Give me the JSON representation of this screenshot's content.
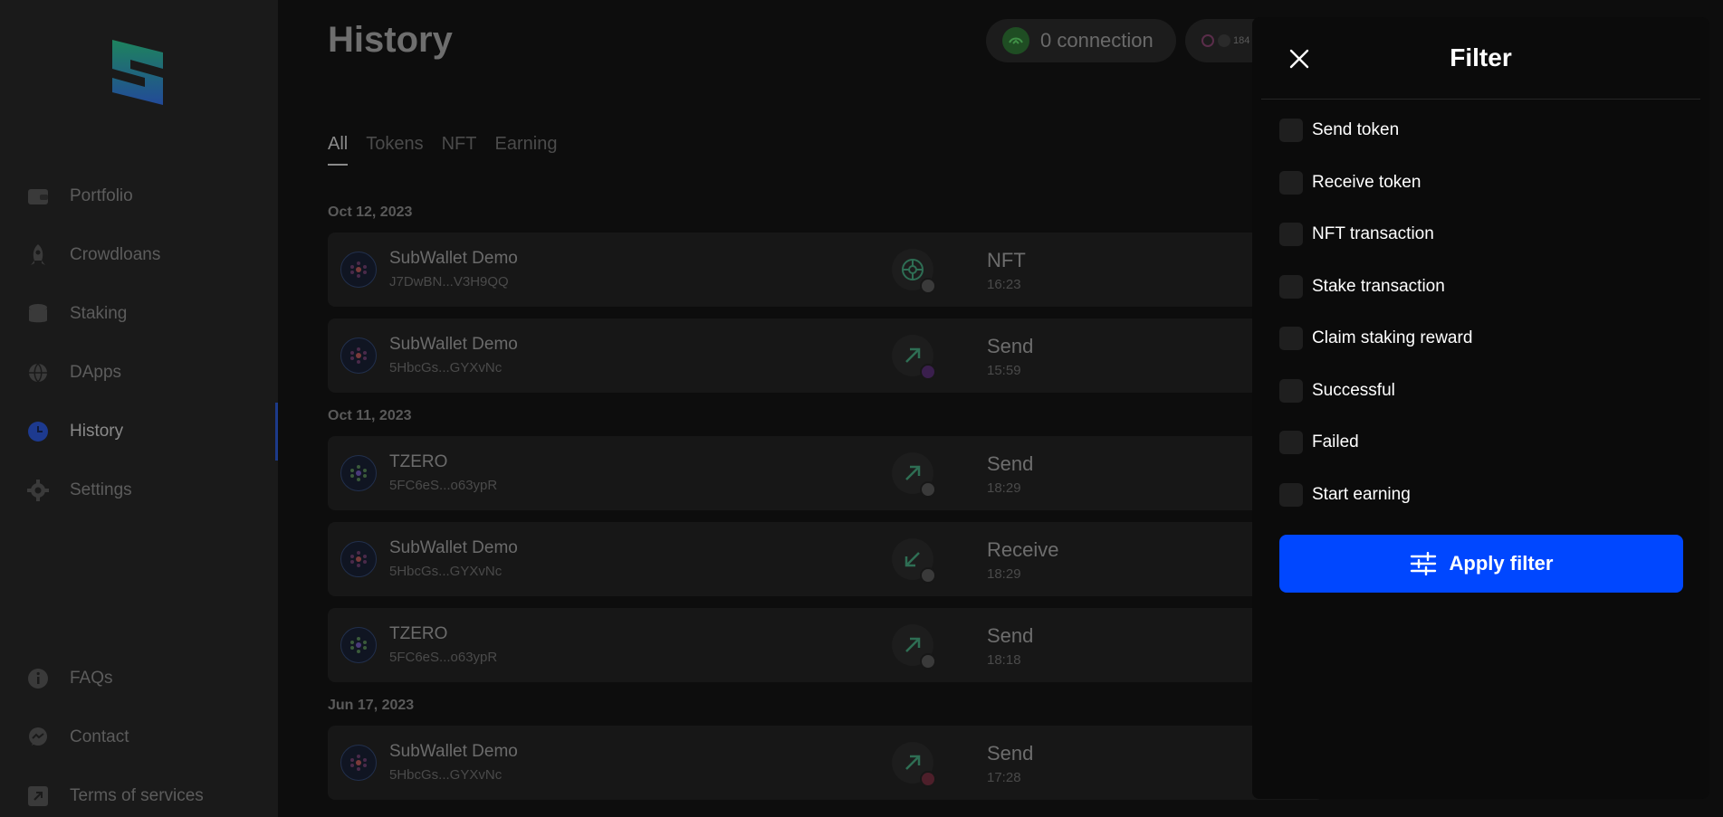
{
  "sidebar": {
    "nav": [
      {
        "label": "Portfolio",
        "icon": "wallet-icon"
      },
      {
        "label": "Crowdloans",
        "icon": "rocket-icon"
      },
      {
        "label": "Staking",
        "icon": "database-icon"
      },
      {
        "label": "DApps",
        "icon": "globe-icon"
      },
      {
        "label": "History",
        "icon": "clock-icon"
      },
      {
        "label": "Settings",
        "icon": "gear-icon"
      }
    ],
    "footer": [
      {
        "label": "FAQs",
        "icon": "info-icon"
      },
      {
        "label": "Contact",
        "icon": "chat-icon"
      },
      {
        "label": "Terms of services",
        "icon": "external-link-icon"
      }
    ]
  },
  "header": {
    "title": "History",
    "connection": "0 connection",
    "account_badge": "184"
  },
  "tabs": [
    "All",
    "Tokens",
    "NFT",
    "Earning"
  ],
  "history": [
    {
      "date": "Oct 12, 2023"
    },
    {
      "name": "SubWallet Demo",
      "address": "J7DwBN...V3H9QQ",
      "type": "NFT",
      "time": "16:23"
    },
    {
      "name": "SubWallet Demo",
      "address": "5HbcGs...GYXvNc",
      "type": "Send",
      "time": "15:59"
    },
    {
      "date": "Oct 11, 2023"
    },
    {
      "name": "TZERO",
      "address": "5FC6eS...o63ypR",
      "type": "Send",
      "time": "18:29"
    },
    {
      "name": "SubWallet Demo",
      "address": "5HbcGs...GYXvNc",
      "type": "Receive",
      "time": "18:29"
    },
    {
      "name": "TZERO",
      "address": "5FC6eS...o63ypR",
      "type": "Send",
      "time": "18:18"
    },
    {
      "date": "Jun 17, 2023"
    },
    {
      "name": "SubWallet Demo",
      "address": "5HbcGs...GYXvNc",
      "type": "Send",
      "time": "17:28"
    }
  ],
  "filter": {
    "title": "Filter",
    "options": [
      "Send token",
      "Receive token",
      "NFT transaction",
      "Stake transaction",
      "Claim staking reward",
      "Successful",
      "Failed",
      "Start earning"
    ],
    "apply_label": "Apply filter"
  },
  "colors": {
    "accent": "#0047ff",
    "background": "#0c0c0c",
    "panel": "#0b0b0b"
  }
}
